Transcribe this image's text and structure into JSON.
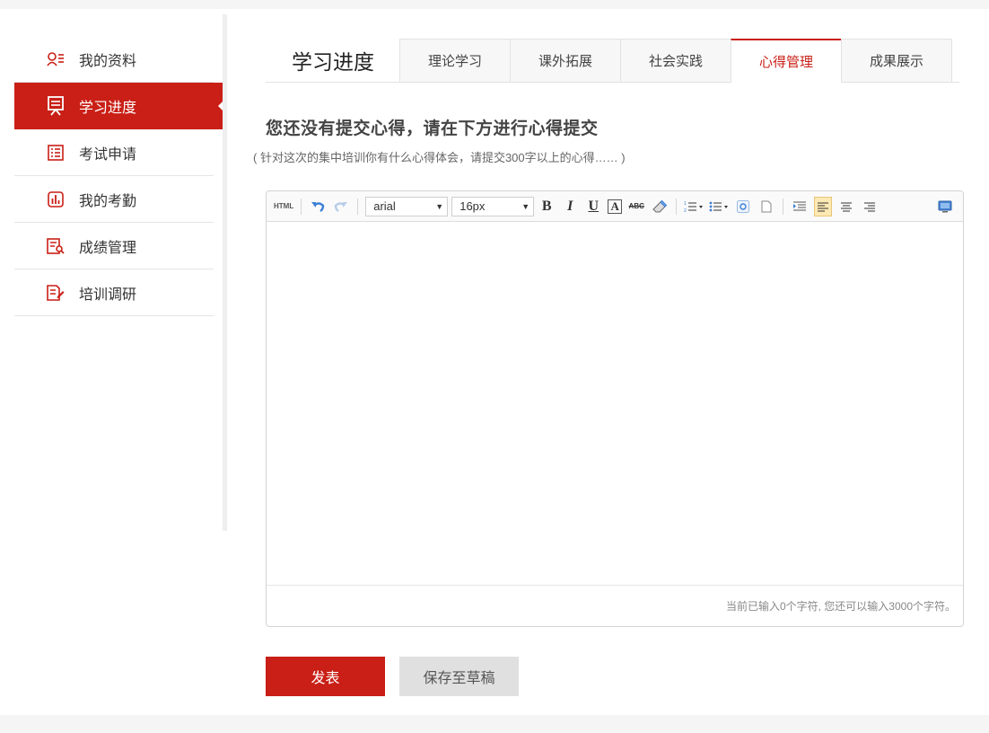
{
  "sidebar": {
    "items": [
      {
        "label": "我的资料",
        "icon": "profile-icon"
      },
      {
        "label": "学习进度",
        "icon": "presentation-icon"
      },
      {
        "label": "考试申请",
        "icon": "list-icon"
      },
      {
        "label": "我的考勤",
        "icon": "chart-icon"
      },
      {
        "label": "成绩管理",
        "icon": "document-search-icon"
      },
      {
        "label": "培训调研",
        "icon": "edit-document-icon"
      }
    ],
    "active_index": 1
  },
  "tabs": {
    "section_title": "学习进度",
    "items": [
      "理论学习",
      "课外拓展",
      "社会实践",
      "心得管理",
      "成果展示"
    ],
    "active_index": 3
  },
  "main": {
    "headline": "您还没有提交心得，请在下方进行心得提交",
    "subline": "( 针对这次的集中培训你有什么心得体会，请提交300字以上的心得…… )"
  },
  "editor": {
    "toolbar": {
      "html_label": "HTML",
      "font_family": "arial",
      "font_size": "16px",
      "bold_label": "B",
      "italic_label": "I",
      "underline_label": "U",
      "fontcolor_label": "A",
      "strike_label": "ABC"
    },
    "status_text": "当前已输入0个字符, 您还可以输入3000个字符。"
  },
  "actions": {
    "submit_label": "发表",
    "save_draft_label": "保存至草稿"
  },
  "colors": {
    "accent": "#c91f16"
  }
}
